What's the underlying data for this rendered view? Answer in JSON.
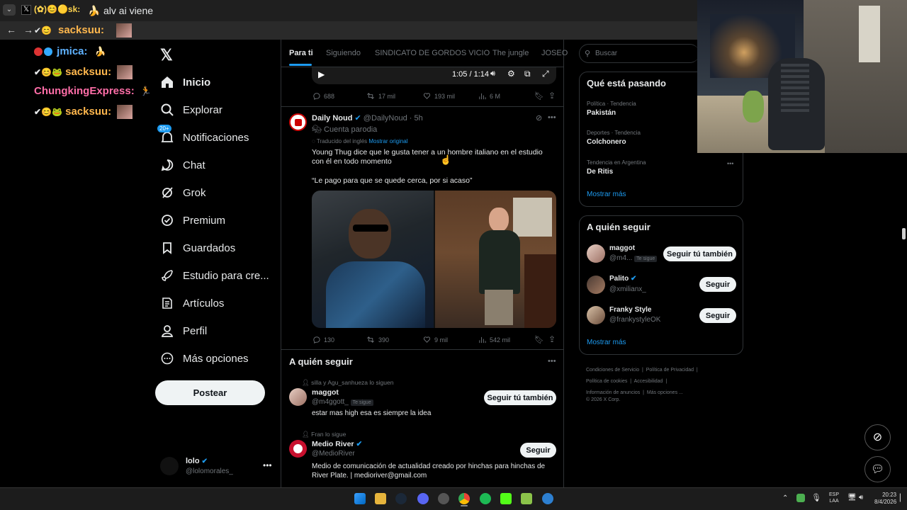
{
  "browser": {
    "tab_title": "alv ai viene",
    "stream_user": "sacksuu:"
  },
  "chat": [
    {
      "user": "jmica:",
      "color": "#5fb2ff"
    },
    {
      "user": "sacksuu:",
      "color": "#ffb74d"
    },
    {
      "user": "ChungkingExpress:",
      "color": "#ff6ea8"
    },
    {
      "user": "sacksuu:",
      "color": "#ffb74d"
    }
  ],
  "nav": {
    "items": [
      {
        "label": "Inicio",
        "icon": "home-icon"
      },
      {
        "label": "Explorar",
        "icon": "search-icon"
      },
      {
        "label": "Notificaciones",
        "icon": "bell-icon",
        "badge": "20+"
      },
      {
        "label": "Chat",
        "icon": "chat-icon"
      },
      {
        "label": "Grok",
        "icon": "grok-icon"
      },
      {
        "label": "Premium",
        "icon": "premium-icon"
      },
      {
        "label": "Guardados",
        "icon": "bookmark-icon"
      },
      {
        "label": "Estudio para cre...",
        "icon": "rocket-icon"
      },
      {
        "label": "Artículos",
        "icon": "article-icon"
      },
      {
        "label": "Perfil",
        "icon": "profile-icon"
      },
      {
        "label": "Más opciones",
        "icon": "more-icon"
      }
    ],
    "post_label": "Postear",
    "account_name": "lolo",
    "account_handle": "@lolomorales_"
  },
  "tabs": [
    "Para ti",
    "Siguiendo",
    "SINDICATO DE GORDOS VICIO",
    "The jungle",
    "JOSEO"
  ],
  "video": {
    "time": "1:05 / 1:14"
  },
  "prev_stats": {
    "replies": "688",
    "reposts": "17 mil",
    "likes": "193 mil",
    "views": "6 M"
  },
  "tweet": {
    "name": "Daily Noud",
    "handle": "@DailyNoud",
    "time": "· 5h",
    "parody_label": "Cuenta parodia",
    "translated": "Traducido del inglés",
    "show_original": "Mostrar original",
    "text_1": "Young Thug dice que le gusta tener a un hombre italiano en el estudio con él en todo momento",
    "text_2": "“Le pago para que se quede cerca, por si acaso”",
    "stats": {
      "replies": "130",
      "reposts": "390",
      "likes": "9 mil",
      "views": "542 mil"
    }
  },
  "who_to_follow_feed": {
    "title": "A quién seguir",
    "items": [
      {
        "context": "silla y Agu_sanhueza lo siguen",
        "name": "maggot",
        "handle": "@m4ggott_",
        "follows_you": "Te sigue",
        "bio": "estar mas high esa es siempre la idea",
        "button": "Seguir tú también"
      },
      {
        "context": "Fran lo sigue",
        "name": "Medio River",
        "handle": "@MedioRiver",
        "bio": "Medio de comunicación de actualidad creado por hinchas para hinchas de River Plate. | medioriver@gmail.com",
        "button": "Seguir"
      }
    ]
  },
  "search": {
    "placeholder": "Buscar"
  },
  "trends": {
    "title": "Qué está pasando",
    "items": [
      {
        "context": "Política · Tendencia",
        "name": "Pakistán"
      },
      {
        "context": "Deportes · Tendencia",
        "name": "Colchonero"
      },
      {
        "context": "Tendencia en Argentina",
        "name": "De Ritis"
      }
    ],
    "show_more": "Mostrar más"
  },
  "who_to_follow": {
    "title": "A quién seguir",
    "items": [
      {
        "name": "maggot",
        "handle": "@m4...",
        "follows_you": "Te sigue",
        "button": "Seguir tú también"
      },
      {
        "name": "Palito",
        "handle": "@xmilianx_",
        "button": "Seguir"
      },
      {
        "name": "Franky Style",
        "handle": "@frankystyleOK",
        "button": "Seguir"
      }
    ],
    "show_more": "Mostrar más"
  },
  "footer": {
    "links": [
      "Condiciones de Servicio",
      "Política de Privacidad",
      "Política de cookies",
      "Accesibilidad",
      "Información de anuncios",
      "Más opciones ..."
    ],
    "copyright": "© 2026 X Corp."
  },
  "taskbar": {
    "lang": "ESP",
    "lang2": "LAA",
    "time": "20:23",
    "date": "8/4/2026"
  },
  "colors": {
    "accent": "#1d9bf0",
    "background": "#000000",
    "border": "#2f3336"
  }
}
